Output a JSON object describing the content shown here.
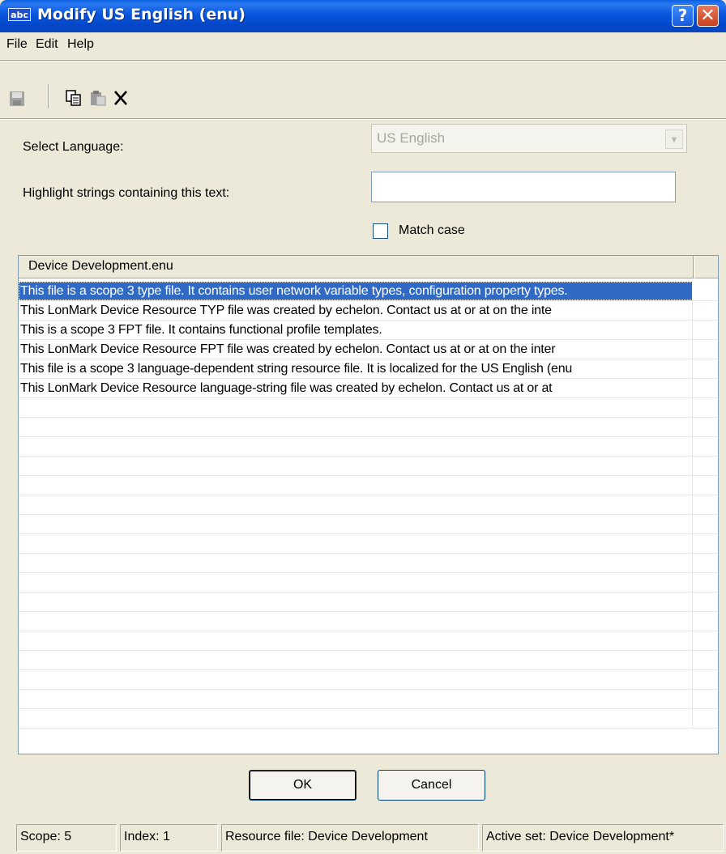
{
  "window": {
    "icon_text": "abc",
    "title": "Modify US English (enu)",
    "help_glyph": "?",
    "close_glyph": "✕"
  },
  "menu": [
    "File",
    "Edit",
    "Help"
  ],
  "toolbar": {
    "tools": [
      "save-icon",
      "copy-icon",
      "paste-icon",
      "delete-icon"
    ]
  },
  "form": {
    "select_language_label": "Select Language:",
    "language_value": "US English",
    "highlight_label": "Highlight strings containing this text:",
    "highlight_value": "",
    "match_case_label": "Match case",
    "match_case_checked": false
  },
  "list": {
    "column_header": "Device Development.enu",
    "selected_index": 0,
    "rows": [
      "This file is a scope 3 type file. It contains user network variable types, configuration property types.",
      "This LonMark Device Resource TYP file was created by echelon. Contact us at  or at  on the inte",
      "This is a scope 3 FPT file. It contains functional profile templates.",
      "This LonMark Device Resource FPT file was created by echelon. Contact us at  or at  on the inter",
      "This file is a scope 3 language-dependent string resource file. It is localized for the US English (enu",
      "This LonMark Device Resource language-string file was created by echelon. Contact us at  or at"
    ],
    "empty_row_count": 17
  },
  "buttons": {
    "ok": "OK",
    "cancel": "Cancel"
  },
  "status": {
    "scope": "Scope: 5",
    "index": "Index: 1",
    "resource_file": "Resource file: Device Development",
    "active_set": "Active set: Device Development*"
  },
  "colors": {
    "title_bar": "#0855dd",
    "selection": "#316ac5",
    "face": "#ece9d8"
  }
}
